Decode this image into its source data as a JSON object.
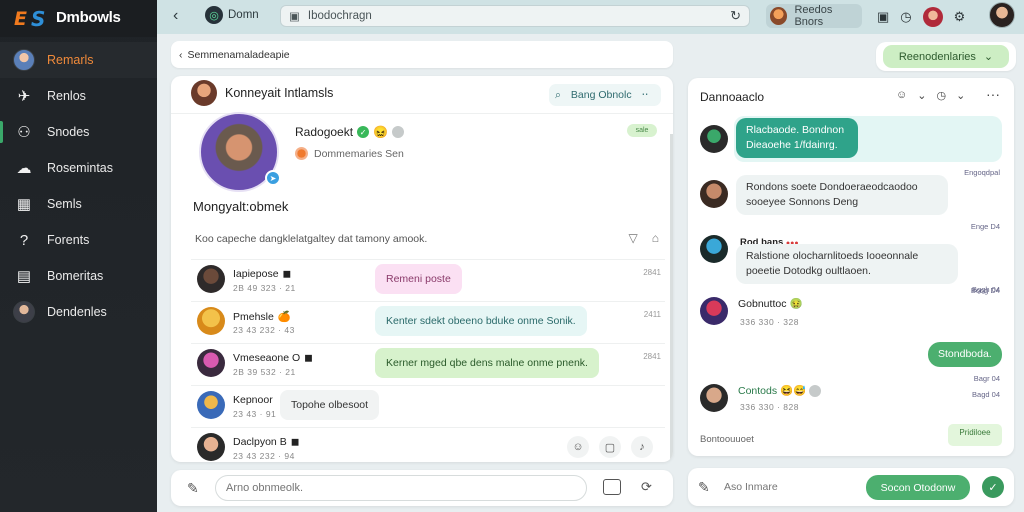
{
  "app": {
    "name": "Dmbowls"
  },
  "sidebar": {
    "items": [
      {
        "label": "Remarls",
        "icon": "avatar"
      },
      {
        "label": "Renlos",
        "icon": "announce-icon"
      },
      {
        "label": "Snodes",
        "icon": "people-icon"
      },
      {
        "label": "Rosemintas",
        "icon": "chat-icon"
      },
      {
        "label": "Semls",
        "icon": "grid-icon"
      },
      {
        "label": "Forents",
        "icon": "help-icon"
      },
      {
        "label": "Bomeritas",
        "icon": "folder-icon"
      },
      {
        "label": "Dendenles",
        "icon": "avatar"
      }
    ]
  },
  "topbar": {
    "brand_label": "Domn",
    "address": "Ibodochragn",
    "user_chip_label": "Reedos Bnors",
    "avatar_color": "#b02a3a"
  },
  "breadcrumb": {
    "text": "Semmenamaladeapie"
  },
  "action_pill": {
    "label": "Reenodenlaries"
  },
  "main": {
    "header_name": "Konneyait Intlamsls",
    "search_pill": "Bang Obnolc",
    "profile": {
      "name": "Radogoekt",
      "subtitle": "Dommemaries Sen",
      "tag": "sale"
    },
    "section_title": "Mongyalt:obmek",
    "description": "Koo capeche dangklelatgaltey dat tamony amook.",
    "messages": [
      {
        "name": "Iapiepose",
        "meta": "2B 49 323 · 21",
        "bubble": "Remeni poste",
        "style": "pink",
        "time": "2841",
        "avatar": [
          "#6b4a3a",
          "#2e2a2a"
        ]
      },
      {
        "name": "Pmehsle",
        "meta": "23 43 232 · 43",
        "bubble": "Kenter sdekt obeeno bduke onme Sonik.",
        "style": "mint",
        "time": "2411",
        "avatar": [
          "#f3c24a",
          "#d88a1a"
        ]
      },
      {
        "name": "Vmeseaone O",
        "meta": "2B 39 532 · 21",
        "bubble": "Kerner mged  qbe dens malne onme pnenk.",
        "style": "green",
        "time": "2841",
        "avatar": [
          "#d85ab0",
          "#3a2a3e"
        ]
      },
      {
        "name": "Kepnoor",
        "meta": "23 43 · 91",
        "bubble": "Topohe olbesoot",
        "style": "gray",
        "time": "",
        "avatar": [
          "#f0b84a",
          "#3a6ab8"
        ]
      },
      {
        "name": "Daclpyon B",
        "meta": "23 43 232 · 94",
        "bubble": "",
        "style": "",
        "time": "",
        "avatar": [
          "#e6b292",
          "#2a2a2a"
        ]
      }
    ]
  },
  "composer": {
    "placeholder": "Arno obnmeolk."
  },
  "right_panel": {
    "title": "Dannoaaclo",
    "messages": [
      {
        "text": "Rlacbaode. Bondnon Dieaoehe 1/fdainrg.",
        "time": ""
      },
      {
        "text": "Rondons soete Dondoeraeodcaodoo sooeyee Sonnons Deng",
        "time": "Engoqdpal"
      },
      {
        "label": "Rod bans",
        "text": "Ralstione olocharnlitoeds Iooeonnale poeetie Dotodkg oultlaoen.",
        "time": "Boog D4"
      },
      {
        "name": "Gobnuttoc",
        "meta": "336 330 · 328",
        "time": "Bagh 04"
      },
      {
        "text": "Stondboda.",
        "time": "Bagr 04"
      },
      {
        "name": "Contods",
        "meta": "336 330 · 828",
        "time": ""
      }
    ],
    "status": "Bontoouuoet",
    "status_tag": "Pridiloee",
    "right_times": [
      "Enge D4",
      "Bggh 04",
      "Bagd 04"
    ]
  },
  "composer_right": {
    "placeholder": "Aso Inmare",
    "send_label": "Socon Otodonw"
  }
}
